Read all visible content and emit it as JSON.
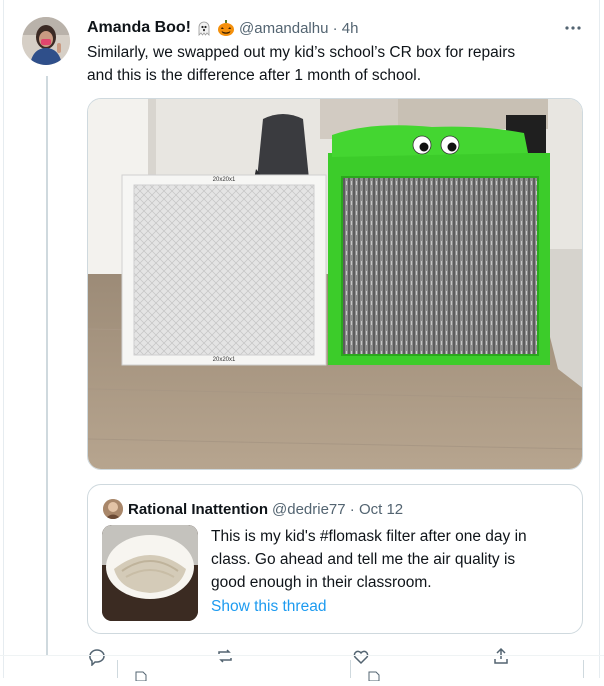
{
  "tweet": {
    "display_name": "Amanda Boo!",
    "emoji_icons": [
      "ghost-icon",
      "jack-o-lantern-icon"
    ],
    "handle_time": "@amandalhu · 4h",
    "text_lines": [
      "Similarly, we swapped out my kid’s school’s CR box for repairs",
      "and this is the difference after 1 month of school."
    ],
    "filter_label_top": "20x20x1",
    "filter_label_bottom": "20x20x1"
  },
  "quote": {
    "display_name": "Rational Inattention",
    "handle_time": "@dedrie77 · Oct 12",
    "text_lines": [
      "This is my kid's #flomask filter after one day in",
      "class. Go ahead and tell me the air quality is",
      "good enough in their classroom."
    ],
    "link": "Show this thread"
  },
  "colors": {
    "link_blue": "#1d9bf0",
    "secondary_text": "#536471",
    "tape_green": "#3ccc2a"
  }
}
